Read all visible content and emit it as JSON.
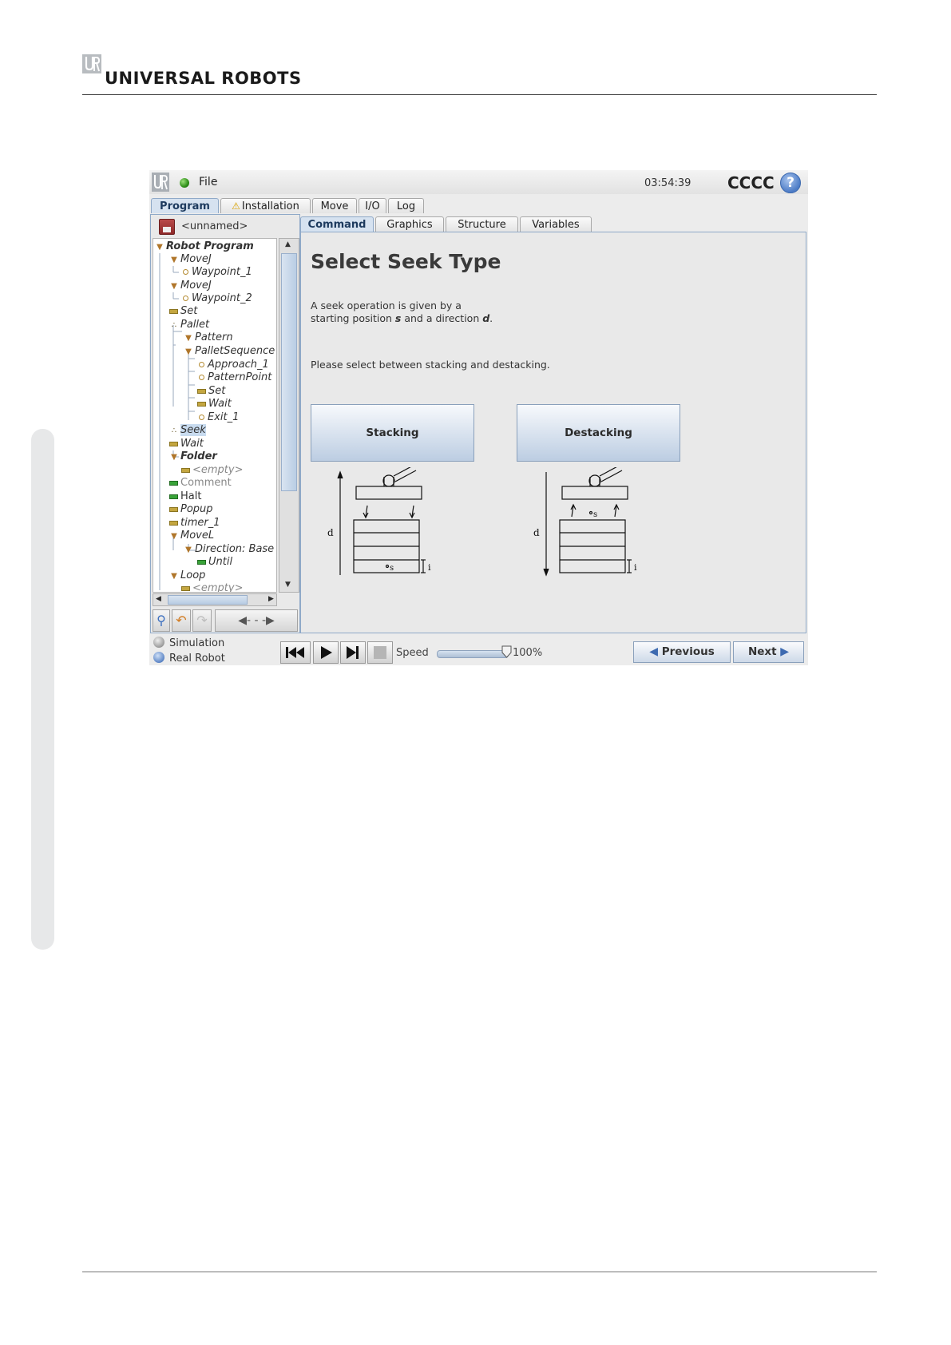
{
  "doc": {
    "brand": "UNIVERSAL ROBOTS"
  },
  "window": {
    "menu_file": "File",
    "clock": "03:54:39",
    "robot_name": "CCCC",
    "help": "?",
    "main_tabs": [
      {
        "label": "Program",
        "active": true
      },
      {
        "label": "Installation",
        "warning": true
      },
      {
        "label": "Move"
      },
      {
        "label": "I/O"
      },
      {
        "label": "Log"
      }
    ],
    "program_name": "<unnamed>",
    "tree": [
      {
        "label": "Robot Program",
        "style": "bold",
        "icon": "triangle"
      },
      {
        "label": "MoveJ",
        "style": "italic",
        "icon": "triangle"
      },
      {
        "label": "Waypoint_1",
        "style": "italic",
        "icon": "waypoint"
      },
      {
        "label": "MoveJ",
        "style": "italic",
        "icon": "triangle"
      },
      {
        "label": "Waypoint_2",
        "style": "italic",
        "icon": "waypoint"
      },
      {
        "label": "Set",
        "style": "italic",
        "icon": "bar-yellow"
      },
      {
        "label": "Pallet",
        "style": "italic",
        "icon": "pallet"
      },
      {
        "label": "Pattern",
        "style": "italic",
        "icon": "triangle"
      },
      {
        "label": "PalletSequence",
        "style": "italic",
        "icon": "triangle"
      },
      {
        "label": "Approach_1",
        "style": "italic",
        "icon": "waypoint"
      },
      {
        "label": "PatternPoint",
        "style": "italic",
        "icon": "waypoint"
      },
      {
        "label": "Set",
        "style": "italic",
        "icon": "bar-yellow"
      },
      {
        "label": "Wait",
        "style": "italic",
        "icon": "bar-yellow"
      },
      {
        "label": "Exit_1",
        "style": "italic",
        "icon": "waypoint"
      },
      {
        "label": "Seek",
        "style": "italic",
        "icon": "pallet",
        "selected": true
      },
      {
        "label": "Wait",
        "style": "italic",
        "icon": "bar-yellow"
      },
      {
        "label": "Folder",
        "style": "bold",
        "icon": "triangle"
      },
      {
        "label": "<empty>",
        "style": "italic-grey",
        "icon": "bar-yellow"
      },
      {
        "label": "Comment",
        "style": "grey",
        "icon": "bar-green"
      },
      {
        "label": "Halt",
        "style": "normal",
        "icon": "bar-green"
      },
      {
        "label": "Popup",
        "style": "italic",
        "icon": "bar-yellow"
      },
      {
        "label": "timer_1",
        "style": "italic",
        "icon": "bar-yellow"
      },
      {
        "label": "MoveL",
        "style": "italic",
        "icon": "triangle"
      },
      {
        "label": "Direction: Base",
        "style": "italic",
        "icon": "triangle"
      },
      {
        "label": "Until",
        "style": "italic",
        "icon": "bar-green"
      },
      {
        "label": "Loop",
        "style": "italic",
        "icon": "triangle"
      },
      {
        "label": "<empty>",
        "style": "italic-grey",
        "icon": "bar-yellow"
      }
    ],
    "sub_tabs": [
      {
        "label": "Command",
        "active": true
      },
      {
        "label": "Graphics"
      },
      {
        "label": "Structure"
      },
      {
        "label": "Variables"
      }
    ],
    "content": {
      "title": "Select Seek Type",
      "desc_line1": "A seek operation is given by a",
      "desc_line2_pre": "starting position ",
      "desc_s": "s",
      "desc_line2_mid": " and a direction ",
      "desc_d": "d",
      "desc_line2_end": ".",
      "prompt": "Please select between stacking and destacking.",
      "stacking_label": "Stacking",
      "destacking_label": "Destacking",
      "diagram_d": "d",
      "diagram_s": "s",
      "diagram_i": "i"
    },
    "bottom": {
      "simulation": "Simulation",
      "real_robot": "Real Robot",
      "speed_label": "Speed",
      "speed_value": "100%",
      "speed_fraction": 1.0,
      "previous": "Previous",
      "next": "Next"
    }
  }
}
